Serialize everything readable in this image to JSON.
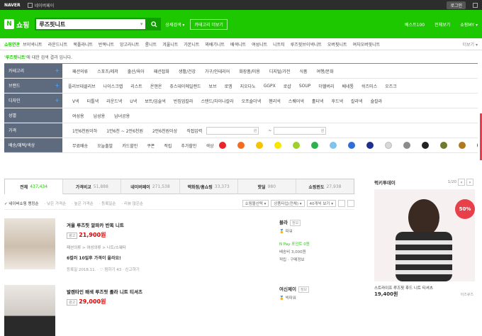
{
  "topbar": {
    "naver": "NAVER",
    "pay": "네이버페이",
    "login": "로그인"
  },
  "header": {
    "logo_n": "N",
    "logo_text": "쇼핑",
    "query": "루즈핏니트",
    "detail": "상세검색 ▾",
    "catmore": "카테고리 더보기",
    "best": "베스트100",
    "allcat": "전체보기",
    "my": "쇼핑MY ▾"
  },
  "nav": {
    "label": "쇼핑연관",
    "items": [
      "브이넥니트",
      "라운드니트",
      "목폴라니트",
      "반목니트",
      "앙고라니트",
      "롱니트",
      "겨울니트",
      "가본니트",
      "꽈배기니트",
      "배색니트",
      "여성니트",
      "니트티",
      "루즈핏브이넥니트",
      "오버핏니트",
      "여자오버핏니트"
    ],
    "more": "더보기 ▾"
  },
  "result": {
    "q": "'루즈핏니트'",
    "rest": "에 대한 검색 결과 입니다."
  },
  "filters": [
    {
      "head": "카테고리",
      "plus": "+",
      "items": [
        "패션의류",
        "스포츠/레저",
        "출산/육아",
        "패션잡화",
        "생활/건강",
        "가구/인테리어",
        "화장품/미용",
        "디지털/가전",
        "식품",
        "여행/문화"
      ]
    },
    {
      "head": "브랜드",
      "plus": "+",
      "items": [
        "플리브데클리브",
        "나이스크랩",
        "리스트",
        "온앤온",
        "쥬스데이에일랜드",
        "보브",
        "로엠",
        "지오다노",
        "GGPX",
        "로샵",
        "SOUP",
        "더헬버리",
        "베네통",
        "쉬즈미스",
        "오즈크"
      ]
    },
    {
      "head": "디자인",
      "plus": "+",
      "items": [
        "V넥",
        "터틀넥",
        "라운드넥",
        "U넥",
        "보트/입술넥",
        "반집업칼라",
        "스탠드/차이나칼라",
        "오프숄더넥",
        "헨리넥",
        "스퀘어넥",
        "홀터넥",
        "후드넥",
        "칼라넥",
        "숄칼라"
      ]
    },
    {
      "head": "성별",
      "plus": "",
      "items": [
        "여성용",
        "남성용",
        "남녀공용"
      ]
    }
  ],
  "price": {
    "head": "가격",
    "opts": [
      "1만6천원이하",
      "1만6천 ~ 2만6천원",
      "2만6천원이상"
    ],
    "direct": "직접입력",
    "won": "원",
    "tilde": "~"
  },
  "benefit": {
    "head": "배송/혜택/색상",
    "items": [
      "무료배송",
      "오늘출발",
      "카드할인",
      "쿠폰",
      "적립",
      "추가할인"
    ],
    "color_label": "색상"
  },
  "colors": [
    "#e8262a",
    "#f26b21",
    "#f7c300",
    "#f7e600",
    "#9dd12a",
    "#2bb24c",
    "#7fc3ef",
    "#2f6ed8",
    "#1e2f8f",
    "#d8d8d8",
    "#8c8c8c",
    "#222222",
    "#6f7a2a",
    "#b0781f",
    "#a826c4",
    "#6a2a9a",
    "#f4a7c8",
    "#f25c8f"
  ],
  "tabs": [
    {
      "label": "전체",
      "count": "437,434"
    },
    {
      "label": "가격비교",
      "count": "51,888"
    },
    {
      "label": "네이버페이",
      "count": "271,538"
    },
    {
      "label": "백화점/홈쇼핑",
      "count": "33,373"
    },
    {
      "label": "핫딜",
      "count": "980"
    },
    {
      "label": "쇼핑윈도",
      "count": "27,938"
    }
  ],
  "sort": {
    "selected": "✓ 네이버쇼핑 랭킹순",
    "opts": [
      "· 낮은 가격순",
      "· 높은 가격순",
      "· 등록일순",
      "· 리뷰 많은순"
    ],
    "dd1": "쇼핑몰선택 ▾",
    "dd2": "상품타입(전체) ▾",
    "dd3": "40개씩 보기 ▾"
  },
  "items": [
    {
      "title": "겨울 루즈핏 알파카 반목 니트",
      "ad": "광고",
      "price": "21,900원",
      "cat": "패션의류 > 여성의류 > 니트/스웨터",
      "hl": "6컬러 10일후 가격이 올라요!",
      "meta": "등록일 2018.11. · ♡ 찜하기 43 · 신고하기",
      "seller": "블라",
      "sbadge": "정보",
      "stag": "파워",
      "npay": "N Pay 포인트 0원",
      "ship": "배송비 3,000원",
      "extra": "적립 · 구매정보"
    },
    {
      "title": "발렌타인 배색 루즈핏 졸라 니트 티셔츠",
      "ad": "광고",
      "price": "29,000원",
      "seller": "여신제이",
      "sbadge": "정보",
      "stag": "빅파워"
    }
  ],
  "side": {
    "title": "럭키투데이",
    "page": "1/20",
    "prev": "‹",
    "next": "›",
    "discount": "50%",
    "name": "스트라이프 루즈핏 후드 니트 티셔츠",
    "price": "19,400원",
    "brand": "이즈큐즈"
  }
}
